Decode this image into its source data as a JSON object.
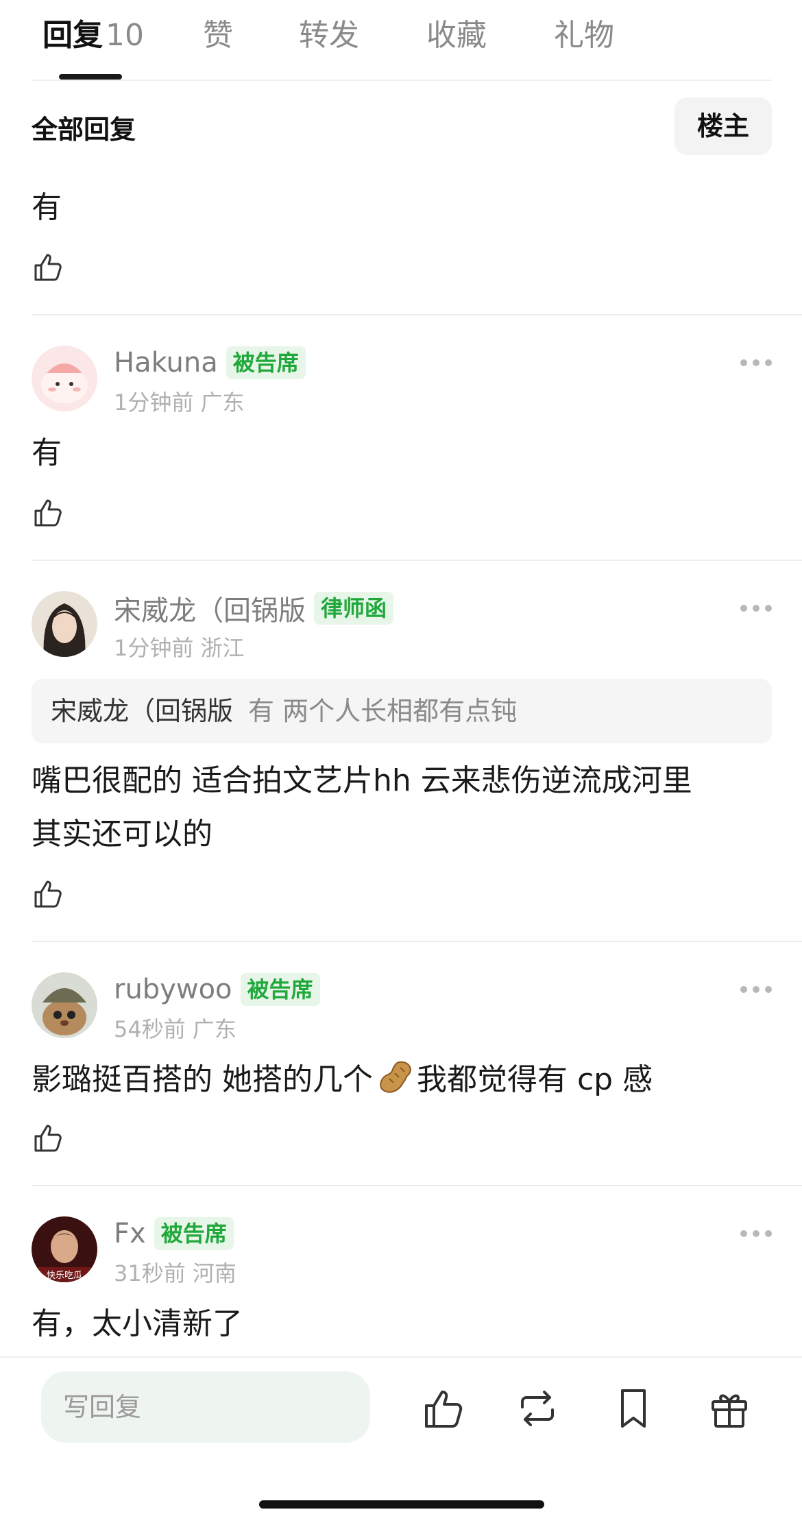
{
  "tabs": [
    {
      "label": "回复",
      "count": "10"
    },
    {
      "label": "赞"
    },
    {
      "label": "转发"
    },
    {
      "label": "收藏"
    },
    {
      "label": "礼物"
    }
  ],
  "section_title": "全部回复",
  "op_filter": "楼主",
  "comments": [
    {
      "text": "有"
    },
    {
      "username": "Hakuna",
      "badge": "被告席",
      "time": "1分钟前",
      "location": "广东",
      "text": "有"
    },
    {
      "username": "宋威龙（回锅版",
      "badge": "律师函",
      "time": "1分钟前",
      "location": "浙江",
      "quote": {
        "name": "宋威龙（回锅版",
        "text": "有 两个人长相都有点钝"
      },
      "text_line1": "嘴巴很配的 适合拍文艺片hh 云来悲伤逆流成河里",
      "text_line2": "其实还可以的"
    },
    {
      "username": "rubywoo",
      "badge": "被告席",
      "time": "54秒前",
      "location": "广东",
      "text_before": "影璐挺百搭的 她搭的几个",
      "emoji_name": "peanut-emoji",
      "text_after": "我都觉得有 cp 感"
    },
    {
      "username": "Fx",
      "badge": "被告席",
      "time": "31秒前",
      "location": "河南",
      "avatar_caption": "快乐吃瓜",
      "text": "有，太小清新了"
    }
  ],
  "bottom_bar": {
    "reply_placeholder": "写回复",
    "icons": [
      "thumbs-up-icon",
      "repost-icon",
      "bookmark-icon",
      "gift-icon"
    ]
  },
  "colors": {
    "badge_green": "#21a83b",
    "badge_bg": "#e8f6ea",
    "reply_input_bg": "#eef4ef"
  }
}
